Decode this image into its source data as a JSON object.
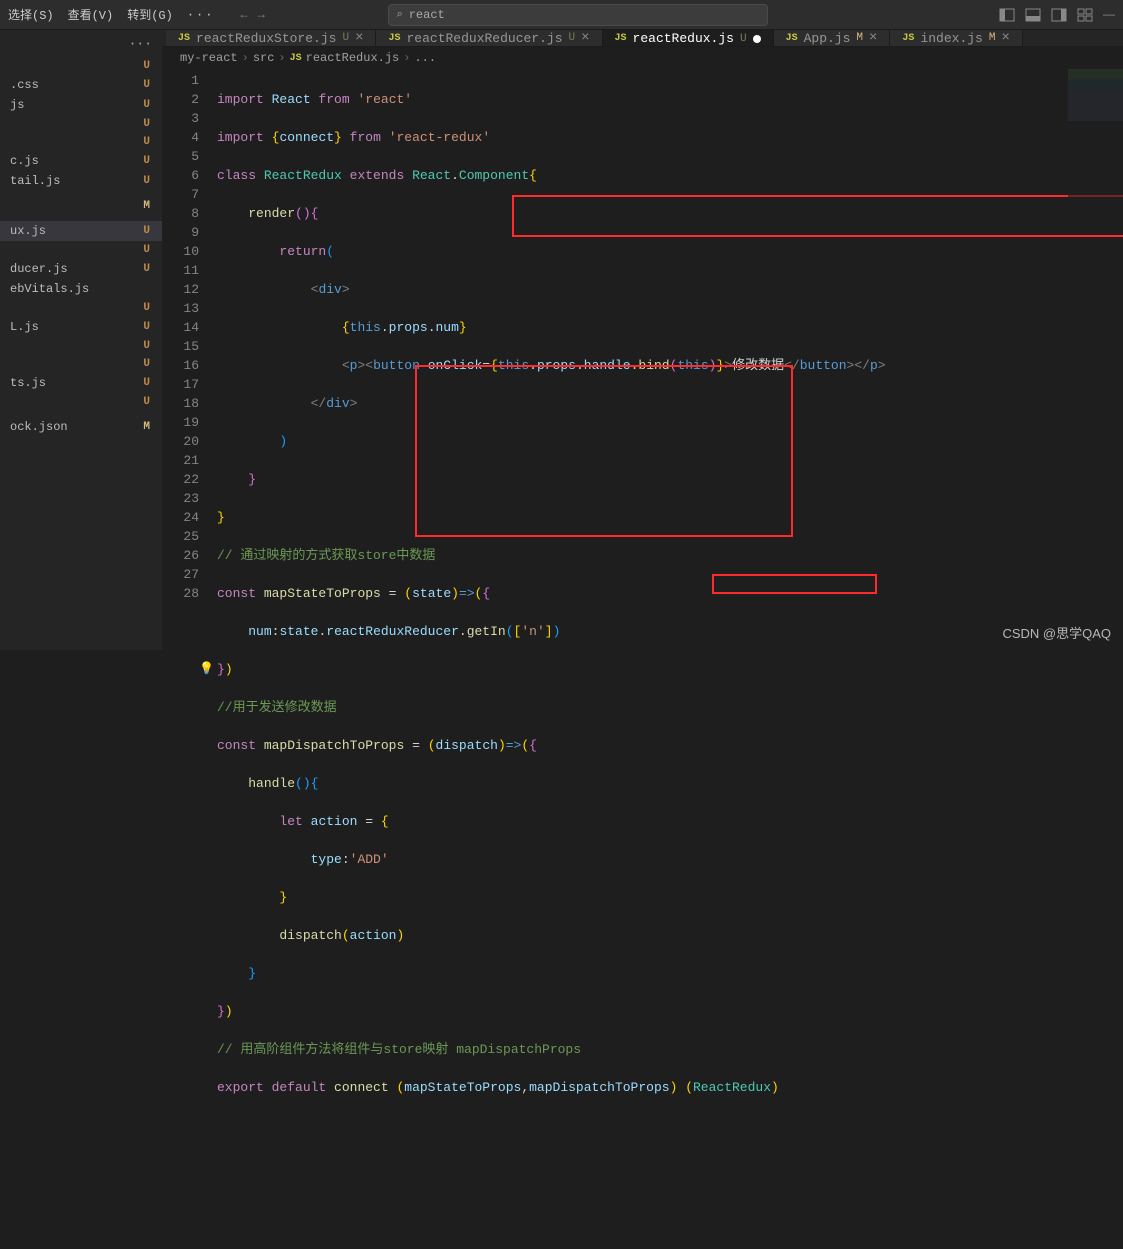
{
  "menu": {
    "select": "选择(S)",
    "view": "查看(V)",
    "go": "转到(G)",
    "more": "···"
  },
  "nav": {
    "back": "←",
    "fwd": "→"
  },
  "search": {
    "icon": "⌕",
    "text": "react"
  },
  "sidebar_head": "···",
  "sidebar": [
    {
      "name": "",
      "status": "U"
    },
    {
      "name": ".css",
      "status": "U"
    },
    {
      "name": "js",
      "status": "U"
    },
    {
      "name": "",
      "status": "U"
    },
    {
      "name": "",
      "status": "U"
    },
    {
      "name": "c.js",
      "status": "U"
    },
    {
      "name": "tail.js",
      "status": "U"
    },
    {
      "name": "",
      "status": ""
    },
    {
      "name": "",
      "status": "M"
    },
    {
      "name": "",
      "status": ""
    },
    {
      "name": "ux.js",
      "status": "U",
      "sel": true
    },
    {
      "name": "",
      "status": "U"
    },
    {
      "name": "ducer.js",
      "status": "U"
    },
    {
      "name": "ebVitals.js",
      "status": ""
    },
    {
      "name": "",
      "status": "U"
    },
    {
      "name": "L.js",
      "status": "U"
    },
    {
      "name": "",
      "status": "U"
    },
    {
      "name": "",
      "status": "U"
    },
    {
      "name": "ts.js",
      "status": "U"
    },
    {
      "name": "",
      "status": "U"
    },
    {
      "name": "",
      "status": ""
    },
    {
      "name": "ock.json",
      "status": "M"
    }
  ],
  "tabs": [
    {
      "label": "reactReduxStore.js",
      "mod": "U"
    },
    {
      "label": "reactReduxReducer.js",
      "mod": "U"
    },
    {
      "label": "reactRedux.js",
      "mod": "U",
      "active": true,
      "dirty": true
    },
    {
      "label": "App.js",
      "mod": "M"
    },
    {
      "label": "index.js",
      "mod": "M"
    }
  ],
  "breadcrumb": {
    "p1": "my-react",
    "p2": "src",
    "js": "JS",
    "file": "reactRedux.js",
    "more": "..."
  },
  "code": {
    "l1": {
      "a": "import",
      "b": "React",
      "c": "from",
      "d": "'react'"
    },
    "l2": {
      "a": "import",
      "b": "{",
      "c": "connect",
      "d": "}",
      "e": "from",
      "f": "'react-redux'"
    },
    "l3": {
      "a": "class",
      "b": "ReactRedux",
      "c": "extends",
      "d": "React",
      "e": ".",
      "f": "Component",
      "g": "{"
    },
    "l4": {
      "a": "render",
      "b": "()",
      "c": "{"
    },
    "l5": {
      "a": "return",
      "b": "("
    },
    "l6": {
      "a": "<",
      "b": "div",
      "c": ">"
    },
    "l7": {
      "a": "{",
      "b": "this",
      "c": ".",
      "d": "props",
      "e": ".",
      "f": "num",
      "g": "}"
    },
    "l8": {
      "a": "<",
      "b": "p",
      "c": "><",
      "d": "button",
      "e": "onClick",
      "f": "=",
      "g": "{",
      "h": "this",
      "i": ".",
      "j": "props",
      "k": ".",
      "l": "handle",
      "m": ".",
      "n": "bind",
      "o": "(",
      "p": "this",
      "q": ")",
      "r": "}",
      "s": ">",
      "t": "修改数据",
      "u": "</",
      "v": "button",
      "w": "></",
      "x": "p",
      "y": ">"
    },
    "l9": {
      "a": "</",
      "b": "div",
      "c": ">"
    },
    "l10": {
      "a": ")"
    },
    "l11": {
      "a": "}"
    },
    "l12": {
      "a": "}"
    },
    "l13": {
      "a": "// 通过映射的方式获取store中数据"
    },
    "l14": {
      "a": "const",
      "b": "mapStateToProps",
      "c": "=",
      "d": "(",
      "e": "state",
      "f": ")",
      "g": "=>",
      "h": "(",
      "i": "{"
    },
    "l15": {
      "a": "num",
      "b": ":",
      "c": "state",
      "d": ".",
      "e": "reactReduxReducer",
      "f": ".",
      "g": "getIn",
      "h": "(",
      "i": "[",
      "j": "'n'",
      "k": "]",
      "l": ")"
    },
    "l16": {
      "a": "}",
      "b": ")"
    },
    "l17": {
      "a": "//用于发送修改数据"
    },
    "l18": {
      "a": "const",
      "b": "mapDispatchToProps",
      "c": "=",
      "d": "(",
      "e": "dispatch",
      "f": ")",
      "g": "=>",
      "h": "(",
      "i": "{"
    },
    "l19": {
      "a": "handle",
      "b": "()",
      "c": "{"
    },
    "l20": {
      "a": "let",
      "b": "action",
      "c": "=",
      "d": "{"
    },
    "l21": {
      "a": "type",
      "b": ":",
      "c": "'ADD'"
    },
    "l22": {
      "a": "}"
    },
    "l23": {
      "a": "dispatch",
      "b": "(",
      "c": "action",
      "d": ")"
    },
    "l24": {
      "a": "}"
    },
    "l25": {
      "a": "}",
      "b": ")"
    },
    "l26": {
      "a": "// 用高阶组件方法将组件与store映射 mapDispatchProps"
    },
    "l27": {
      "a": "export",
      "b": "default",
      "c": "connect",
      "d": "(",
      "e": "mapStateToProps",
      "f": ",",
      "g": "mapDispatchToProps",
      "h": ")",
      "i": "(",
      "j": "ReactRedux",
      "k": ")"
    },
    "l28": ""
  },
  "line_count": 28,
  "watermark": "CSDN @思学QAQ"
}
